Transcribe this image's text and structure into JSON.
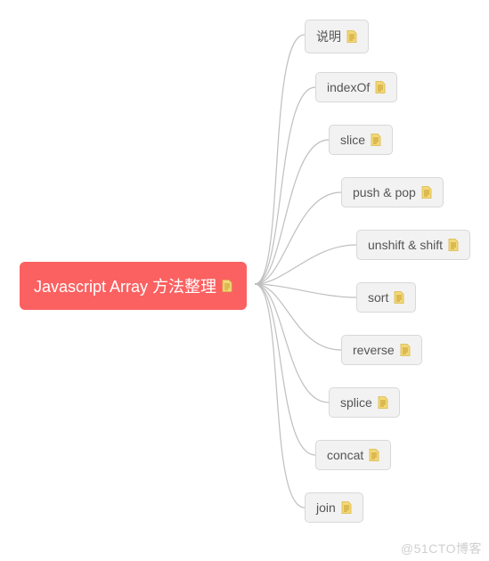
{
  "root": {
    "label": "Javascript Array 方法整理"
  },
  "children": [
    {
      "label": "说明"
    },
    {
      "label": "indexOf"
    },
    {
      "label": "slice"
    },
    {
      "label": "push & pop"
    },
    {
      "label": "unshift & shift"
    },
    {
      "label": "sort"
    },
    {
      "label": "reverse"
    },
    {
      "label": "splice"
    },
    {
      "label": "concat"
    },
    {
      "label": "join"
    }
  ],
  "watermark": "@51CTO博客",
  "colors": {
    "root_bg": "#fb6161",
    "root_text": "#ffffff",
    "child_bg": "#f2f2f2",
    "child_border": "#d8d8d8",
    "child_text": "#555555",
    "connector": "#bfbfbf",
    "icon_fill": "#f3d879",
    "icon_stroke": "#d8b843"
  }
}
